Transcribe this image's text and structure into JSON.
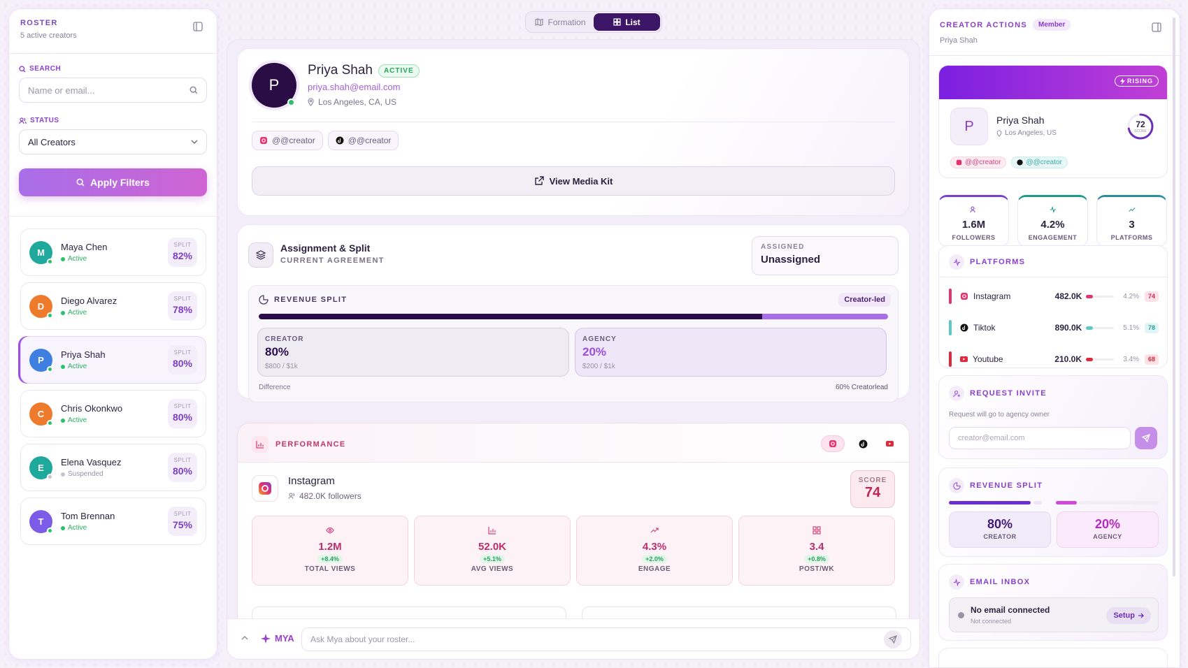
{
  "roster": {
    "title": "ROSTER",
    "subtitle": "5 active creators",
    "search_label": "SEARCH",
    "search_placeholder": "Name or email...",
    "status_label": "STATUS",
    "status_value": "All Creators",
    "apply_label": "Apply Filters",
    "creators": [
      {
        "initial": "M",
        "name": "Maya Chen",
        "status": "Active",
        "split_label": "SPLIT",
        "split": "82%",
        "color": "#1fa89c"
      },
      {
        "initial": "D",
        "name": "Diego Alvarez",
        "status": "Active",
        "split_label": "SPLIT",
        "split": "78%",
        "color": "#ee7a2b"
      },
      {
        "initial": "P",
        "name": "Priya Shah",
        "status": "Active",
        "split_label": "SPLIT",
        "split": "80%",
        "color": "#3f7fe0"
      },
      {
        "initial": "C",
        "name": "Chris Okonkwo",
        "status": "Active",
        "split_label": "SPLIT",
        "split": "80%",
        "color": "#ee7a2b"
      },
      {
        "initial": "E",
        "name": "Elena Vasquez",
        "status": "Suspended",
        "split_label": "SPLIT",
        "split": "80%",
        "color": "#1fa89c"
      },
      {
        "initial": "T",
        "name": "Tom Brennan",
        "status": "Active",
        "split_label": "SPLIT",
        "split": "75%",
        "color": "#7b5be8"
      }
    ]
  },
  "view_toggle": {
    "formation": "Formation",
    "list": "List"
  },
  "profile": {
    "initial": "P",
    "name": "Priya Shah",
    "status_badge": "ACTIVE",
    "email": "priya.shah@email.com",
    "location": "Los Angeles, CA, US",
    "handles": [
      "@@creator",
      "@@creator"
    ],
    "media_kit": "View Media Kit"
  },
  "assignment": {
    "title": "Assignment & Split",
    "subtitle": "CURRENT AGREEMENT",
    "assigned_label": "ASSIGNED",
    "assigned_value": "Unassigned",
    "revenue_label": "REVENUE SPLIT",
    "tag": "Creator-led",
    "creator_split": 0.8,
    "creator_label": "CREATOR",
    "creator_value": "80%",
    "creator_sub": "$800 / $1k",
    "agency_label": "AGENCY",
    "agency_value": "20%",
    "agency_sub": "$200 / $1k",
    "difference_label": "Difference",
    "difference_value": "60% Creatorlead"
  },
  "performance": {
    "title": "PERFORMANCE",
    "platform": "Instagram",
    "followers": "482.0K followers",
    "score_label": "SCORE",
    "score": "74",
    "metrics": [
      {
        "value": "1.2M",
        "delta": "+8.4%",
        "label": "TOTAL VIEWS"
      },
      {
        "value": "52.0K",
        "delta": "+5.1%",
        "label": "AVG VIEWS"
      },
      {
        "value": "4.3%",
        "delta": "+2.0%",
        "label": "ENGAGE"
      },
      {
        "value": "3.4",
        "delta": "+0.8%",
        "label": "POST/WK"
      }
    ]
  },
  "mya": {
    "label": "MYA",
    "placeholder": "Ask Mya about your roster..."
  },
  "actions": {
    "title": "CREATOR ACTIONS",
    "badge": "Member",
    "subtitle": "Priya Shah",
    "rising": "RISING",
    "initial": "P",
    "name": "Priya Shah",
    "location": "Los Angeles, US",
    "score": "72",
    "score_label": "SCORE",
    "score_fraction": 0.72,
    "handles": [
      "@@creator",
      "@@creator"
    ],
    "stats": [
      {
        "value": "1.6M",
        "label": "FOLLOWERS"
      },
      {
        "value": "4.2%",
        "label": "ENGAGEMENT"
      },
      {
        "value": "3",
        "label": "PLATFORMS"
      }
    ],
    "platforms_title": "PLATFORMS",
    "platforms": [
      {
        "name": "Instagram",
        "followers": "482.0K",
        "pct": "4.2%",
        "score": "74",
        "color": "#e0336f"
      },
      {
        "name": "Tiktok",
        "followers": "890.0K",
        "pct": "5.1%",
        "score": "78",
        "color": "#5cc9c8"
      },
      {
        "name": "Youtube",
        "followers": "210.0K",
        "pct": "3.4%",
        "score": "68",
        "color": "#e0273c"
      }
    ],
    "invite_title": "REQUEST INVITE",
    "invite_sub": "Request will go to agency owner",
    "invite_placeholder": "creator@email.com",
    "split_title": "REVENUE SPLIT",
    "creator_value": "80%",
    "creator_label": "CREATOR",
    "agency_value": "20%",
    "agency_label": "AGENCY",
    "email_title": "EMAIL INBOX",
    "email_status": "No email connected",
    "email_sub": "Not connected",
    "setup": "Setup"
  }
}
